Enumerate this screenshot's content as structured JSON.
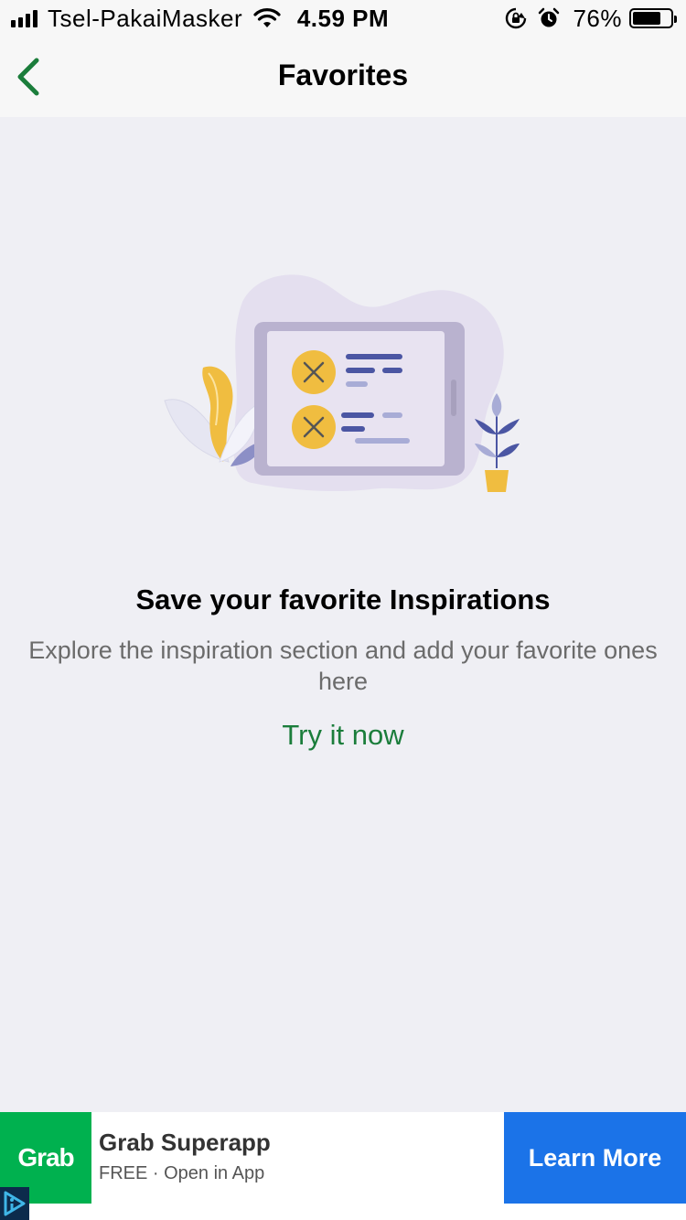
{
  "status_bar": {
    "carrier": "Tsel-PakaiMasker",
    "time": "4.59 PM",
    "battery_percent": "76%",
    "battery_level": 0.76,
    "icons": [
      "signal-icon",
      "wifi-icon",
      "rotation-lock-icon",
      "alarm-icon",
      "battery-icon"
    ]
  },
  "nav": {
    "title": "Favorites",
    "back_icon": "chevron-left-icon",
    "accent": "#1b7d3b"
  },
  "empty_state": {
    "title": "Save your favorite Inspirations",
    "description": "Explore the inspiration section and add your favorite ones here",
    "action": "Try it now"
  },
  "ad": {
    "logo_text": "Grab",
    "title": "Grab Superapp",
    "subtitle": "FREE · Open in App",
    "cta": "Learn More",
    "brand_color": "#00b14f",
    "cta_color": "#1b73e8"
  }
}
